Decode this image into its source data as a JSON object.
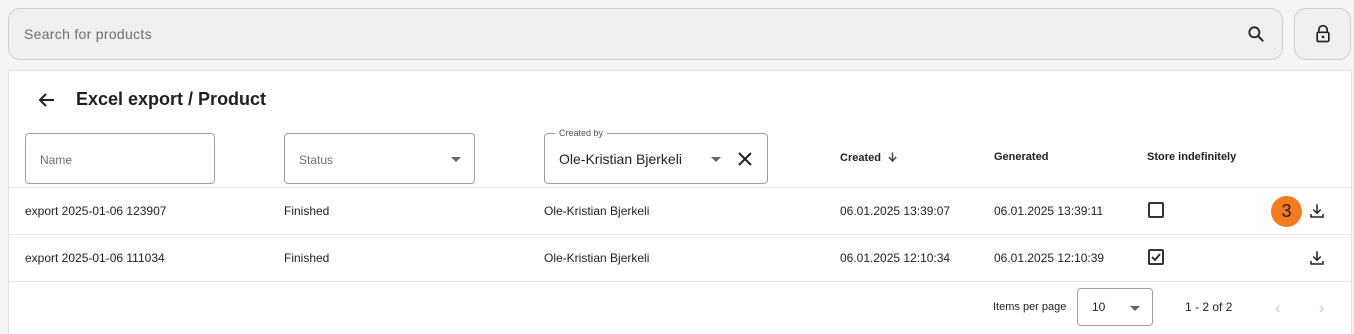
{
  "search": {
    "placeholder": "Search for products"
  },
  "header": {
    "title": "Excel export / Product"
  },
  "filters": {
    "name_label": "Name",
    "status_label": "Status",
    "created_by_label": "Created by",
    "created_by_value": "Ole-Kristian Bjerkeli"
  },
  "columns": {
    "created": "Created",
    "generated": "Generated",
    "store_indefinitely": "Store indefinitely"
  },
  "rows": [
    {
      "name": "export 2025-01-06 123907",
      "status": "Finished",
      "created_by": "Ole-Kristian Bjerkeli",
      "created": "06.01.2025 13:39:07",
      "generated": "06.01.2025 13:39:11",
      "store_indefinitely": false
    },
    {
      "name": "export 2025-01-06 111034",
      "status": "Finished",
      "created_by": "Ole-Kristian Bjerkeli",
      "created": "06.01.2025 12:10:34",
      "generated": "06.01.2025 12:10:39",
      "store_indefinitely": true
    }
  ],
  "badge": {
    "value": "3",
    "color": "#f47c20"
  },
  "pagination": {
    "items_per_page_label": "Items per page",
    "items_per_page_value": "10",
    "range": "1 - 2 of 2"
  },
  "icons": [
    "search-icon",
    "lock-icon",
    "back-arrow-icon",
    "dropdown-caret-icon",
    "clear-icon",
    "sort-down-icon",
    "download-icon",
    "checkbox-icon",
    "chevron-left-icon",
    "chevron-right-icon"
  ]
}
